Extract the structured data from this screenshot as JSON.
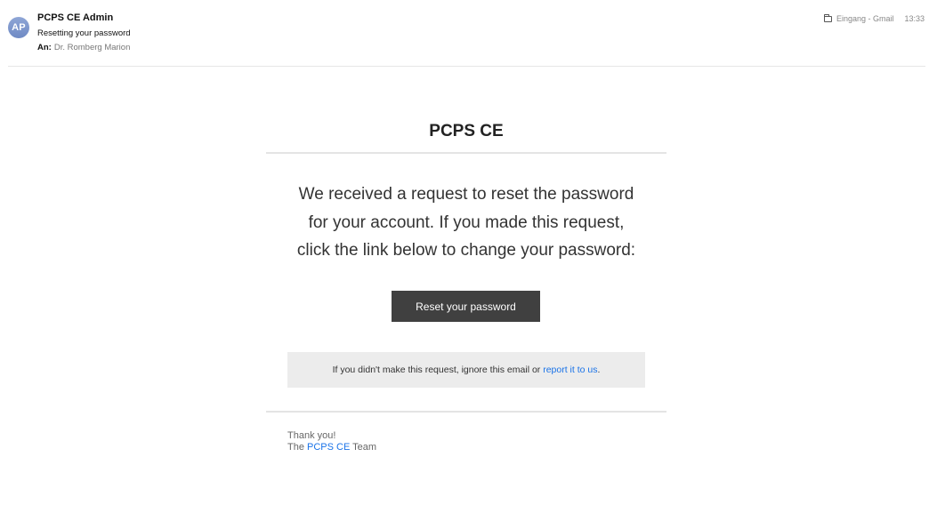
{
  "header": {
    "avatar_initials": "AP",
    "avatar_color": "#7b93c9",
    "sender": "PCPS CE Admin",
    "subject": "Resetting your password",
    "to_label": "An:",
    "to_name": "Dr. Romberg Marion",
    "folder_icon": "folder-icon",
    "folder": "Eingang - Gmail",
    "time": "13:33"
  },
  "email": {
    "brand": "PCPS CE",
    "message_lines": [
      "We received a request to reset the password",
      "for your account. If you made this request,",
      "click the link below to change your password:"
    ],
    "button_label": "Reset your password",
    "button_color": "#404040",
    "notice_text": "If you didn't make this request, ignore this email or ",
    "notice_link": "report it to us",
    "notice_end": ".",
    "link_color": "#1a73e8",
    "thanks": "Thank you!",
    "team_prefix": "The ",
    "team_link": "PCPS CE",
    "team_suffix": " Team"
  }
}
